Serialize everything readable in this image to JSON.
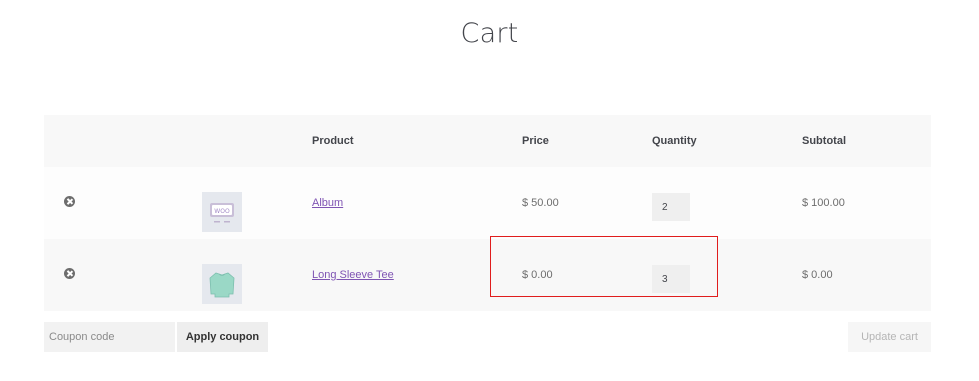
{
  "page": {
    "title": "Cart"
  },
  "table": {
    "headers": {
      "product": "Product",
      "price": "Price",
      "quantity": "Quantity",
      "subtotal": "Subtotal"
    },
    "rows": [
      {
        "name": "Album",
        "price": "$ 50.00",
        "quantity": "2",
        "subtotal": "$ 100.00",
        "thumb_icon": "album-thumbnail"
      },
      {
        "name": "Long Sleeve Tee",
        "price": "$ 0.00",
        "quantity": "3",
        "subtotal": "$ 0.00",
        "thumb_icon": "long-sleeve-tee-thumbnail"
      }
    ]
  },
  "coupon": {
    "placeholder": "Coupon code",
    "apply_label": "Apply coupon"
  },
  "actions": {
    "update_label": "Update cart"
  },
  "colors": {
    "link": "#7f54b3",
    "highlight": "#e01d1d"
  }
}
